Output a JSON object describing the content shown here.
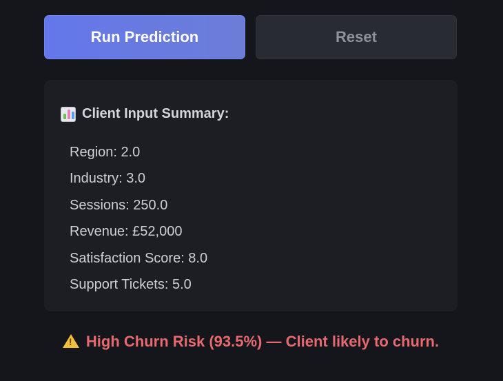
{
  "actions": {
    "run_label": "Run Prediction",
    "reset_label": "Reset"
  },
  "summary": {
    "icon": "bar-chart-icon",
    "title": "Client Input Summary:",
    "rows": [
      "Region: 2.0",
      "Industry: 3.0",
      "Sessions: 250.0",
      "Revenue: £52,000",
      "Satisfaction Score: 8.0",
      "Support Tickets: 5.0"
    ]
  },
  "result": {
    "icon": "warning-icon",
    "text": "High Churn Risk (93.5%) — Client likely to churn.",
    "color": "#e8696e"
  },
  "colors": {
    "primary": "#6477ea",
    "background": "#14161c",
    "card": "#1c1e24"
  }
}
